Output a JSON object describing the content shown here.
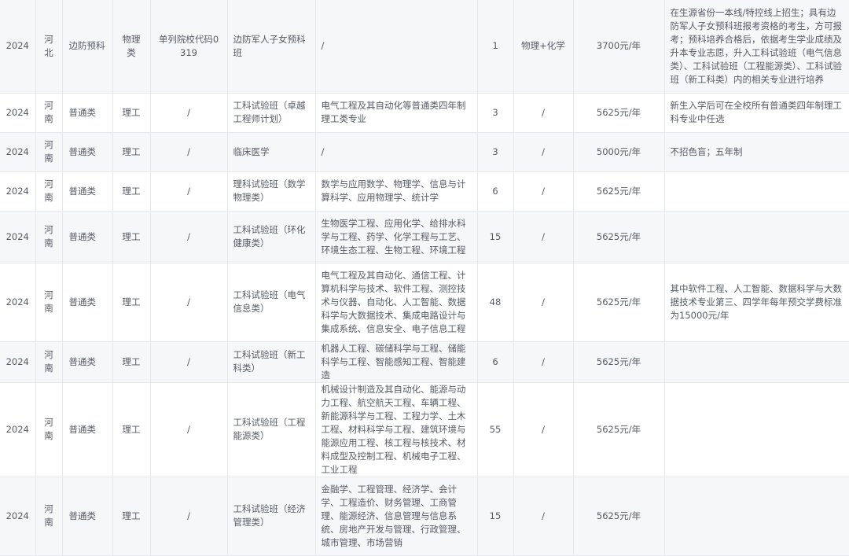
{
  "table": {
    "rows": [
      {
        "year": "2024",
        "province": "河北",
        "batch": "边防预科",
        "subject_type": "物理类",
        "school_code": "单列院校代码0319",
        "major": "边防军人子女预科班",
        "included_majors": "/",
        "plan": "1",
        "requirement": "物理+化学",
        "tuition": "3700元/年",
        "notes": "在生源省份一本线/特控线上招生；具有边防军人子女预科班报考资格的考生，方可报考；预科培养合格后，依据考生学业成绩及升本专业志愿，升入工科试验班（电气信息类）、工科试验班（工程能源类）、工科试验班（新工科类）内的相关专业进行培养"
      },
      {
        "year": "2024",
        "province": "河南",
        "batch": "普通类",
        "subject_type": "理工",
        "school_code": "/",
        "major": "工科试验班（卓越工程师计划）",
        "included_majors": "电气工程及其自动化等普通类四年制理工类专业",
        "plan": "3",
        "requirement": "/",
        "tuition": "5625元/年",
        "notes": "新生入学后可在全校所有普通类四年制理工科专业中任选"
      },
      {
        "year": "2024",
        "province": "河南",
        "batch": "普通类",
        "subject_type": "理工",
        "school_code": "/",
        "major": "临床医学",
        "included_majors": "/",
        "plan": "3",
        "requirement": "/",
        "tuition": "5000元/年",
        "notes": "不招色盲；五年制"
      },
      {
        "year": "2024",
        "province": "河南",
        "batch": "普通类",
        "subject_type": "理工",
        "school_code": "/",
        "major": "理科试验班（数学物理类）",
        "included_majors": "数学与应用数学、物理学、信息与计算科学、应用物理学、统计学",
        "plan": "6",
        "requirement": "/",
        "tuition": "5625元/年",
        "notes": ""
      },
      {
        "year": "2024",
        "province": "河南",
        "batch": "普通类",
        "subject_type": "理工",
        "school_code": "/",
        "major": "工科试验班（环化健康类）",
        "included_majors": "生物医学工程、应用化学、给排水科学与工程、药学、化学工程与工艺、环境生态工程、生物工程、环境工程",
        "plan": "15",
        "requirement": "/",
        "tuition": "5625元/年",
        "notes": ""
      },
      {
        "year": "2024",
        "province": "河南",
        "batch": "普通类",
        "subject_type": "理工",
        "school_code": "/",
        "major": "工科试验班（电气信息类）",
        "included_majors": "电气工程及其自动化、通信工程、计算机科学与技术、软件工程、测控技术与仪器、自动化、人工智能、数据科学与大数据技术、集成电路设计与集成系统、信息安全、电子信息工程",
        "plan": "48",
        "requirement": "/",
        "tuition": "5625元/年",
        "notes": "其中软件工程、人工智能、数据科学与大数据技术专业第三、四学年每年预交学费标准为15000元/年"
      },
      {
        "year": "2024",
        "province": "河南",
        "batch": "普通类",
        "subject_type": "理工",
        "school_code": "/",
        "major": "工科试验班（新工科类）",
        "included_majors": "机器人工程、碳储科学与工程、储能科学与工程、智能感知工程、智能建造",
        "plan": "6",
        "requirement": "/",
        "tuition": "5625元/年",
        "notes": ""
      },
      {
        "year": "2024",
        "province": "河南",
        "batch": "普通类",
        "subject_type": "理工",
        "school_code": "/",
        "major": "工科试验班（工程能源类）",
        "included_majors": "机械设计制造及其自动化、能源与动力工程、航空航天工程、车辆工程、新能源科学与工程、工程力学、土木工程、材料科学与工程、建筑环境与能源应用工程、核工程与核技术、材料成型及控制工程、机械电子工程、工业工程",
        "plan": "55",
        "requirement": "/",
        "tuition": "5625元/年",
        "notes": ""
      },
      {
        "year": "2024",
        "province": "河南",
        "batch": "普通类",
        "subject_type": "理工",
        "school_code": "/",
        "major": "工科试验班（经济管理类）",
        "included_majors": "金融学、工程管理、经济学、会计学、工程造价、财务管理、工商管理、能源经济、信息管理与信息系统、房地产开发与管理、行政管理、城市管理、市场营销",
        "plan": "15",
        "requirement": "/",
        "tuition": "5625元/年",
        "notes": ""
      }
    ]
  }
}
